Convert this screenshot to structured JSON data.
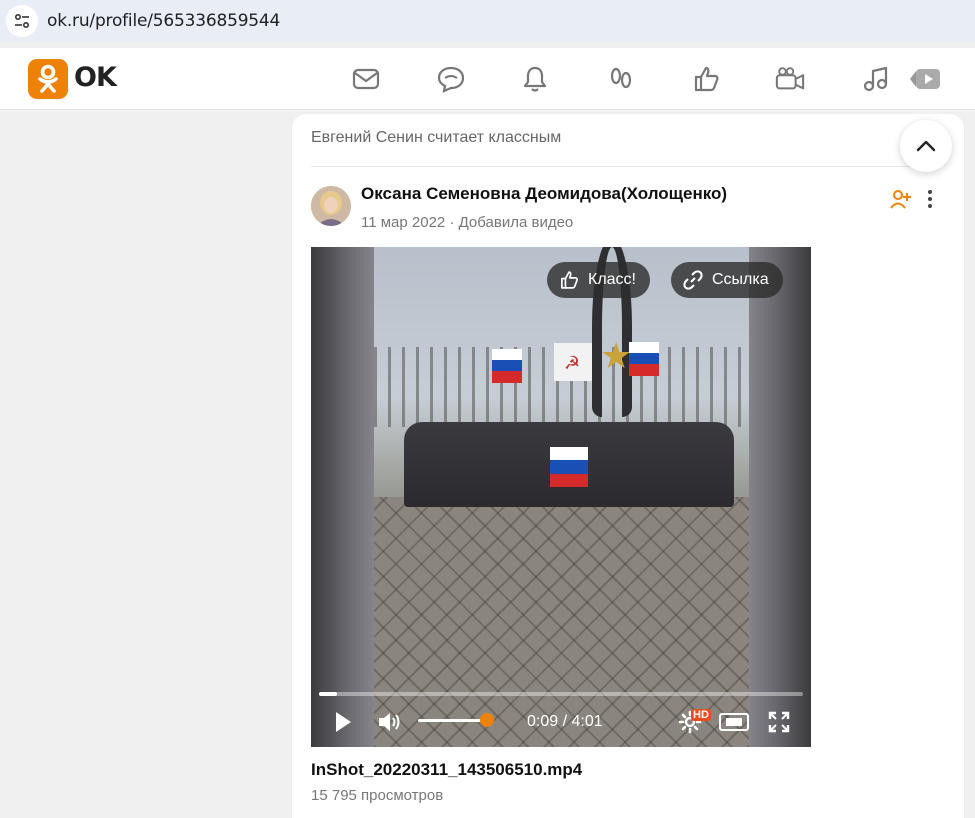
{
  "browser": {
    "url": "ok.ru/profile/565336859544"
  },
  "header": {
    "logo_text": "OK",
    "brand_color": "#ee8208",
    "nav_icons": [
      "messages-icon",
      "discussions-icon",
      "notifications-icon",
      "guests-icon",
      "reactions-icon",
      "video-icon",
      "music-icon",
      "video-showcase-icon"
    ]
  },
  "feed": {
    "liked_by": "Евгений Сенин считает классным",
    "post": {
      "author": "Оксана Семеновна Деомидова(Холощенко)",
      "meta": "11 мар 2022 · Добавила видео",
      "video": {
        "class_button": "Класс!",
        "link_button": "Ссылка",
        "time": "0:09 / 4:01",
        "progress": 0.037,
        "volume": 0.92,
        "quality_badge": "HD"
      },
      "title": "InShot_20220311_143506510.mp4",
      "views": "15 795 просмотров"
    }
  }
}
